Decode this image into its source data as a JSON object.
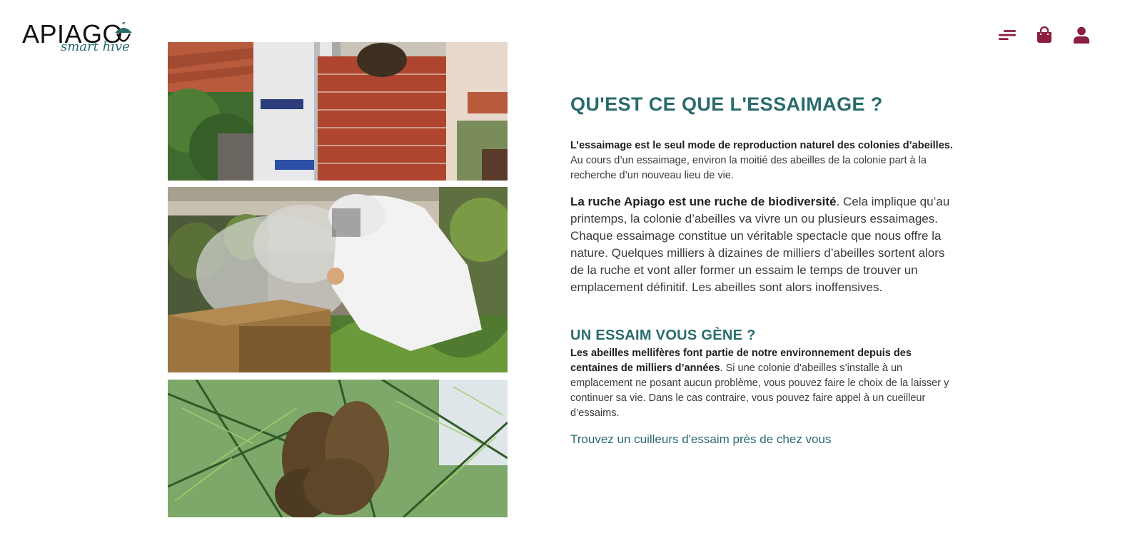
{
  "header": {
    "logo_word": "APIAGO",
    "logo_tagline": "smart hive",
    "icons": [
      "menu-icon",
      "shopping-bag-icon",
      "user-icon"
    ],
    "icon_color": "#8b1e3f"
  },
  "colors": {
    "accent": "#2a6b6c",
    "icon": "#8b1e3f",
    "text": "#3a3a3a"
  },
  "photos": [
    {
      "name": "beekeeper-on-ladder-chimney-photo"
    },
    {
      "name": "beekeeper-smoker-box-photo"
    },
    {
      "name": "swarm-in-pine-tree-photo"
    }
  ],
  "section1": {
    "title": "QU'EST CE QUE L'ESSAIMAGE ?",
    "p1_bold": "L’essaimage est le seul mode de reproduction naturel des colonies d’abeilles.",
    "p1_rest": " Au cours d’un essaimage, environ la moitié des abeilles de la colonie part à la recherche d’un nouveau lieu de vie.",
    "p2_bold": "La ruche Apiago est une ruche de biodiversité",
    "p2_rest": ". Cela implique qu’au printemps, la colonie d’abeilles va vivre un ou plusieurs essaimages. Chaque essaimage constitue un véritable spectacle que nous offre la nature. Quelques milliers à dizaines de milliers d’abeilles sortent alors de la ruche et vont aller former un essaim le temps de trouver un emplacement définitif. Les abeilles sont alors inoffensives."
  },
  "section2": {
    "title": "UN ESSAIM VOUS GÈNE ?",
    "p_bold": "Les abeilles mellifères font partie de notre environnement depuis des centaines de milliers d’années",
    "p_rest": ". Si une colonie d’abeilles s’installe à un emplacement ne posant aucun problème, vous pouvez faire le choix de la laisser y continuer sa vie. Dans le cas contraire, vous pouvez faire appel à un cueilleur d’essaims.",
    "link": "Trouvez un cuilleurs d'essaim près de chez vous"
  }
}
